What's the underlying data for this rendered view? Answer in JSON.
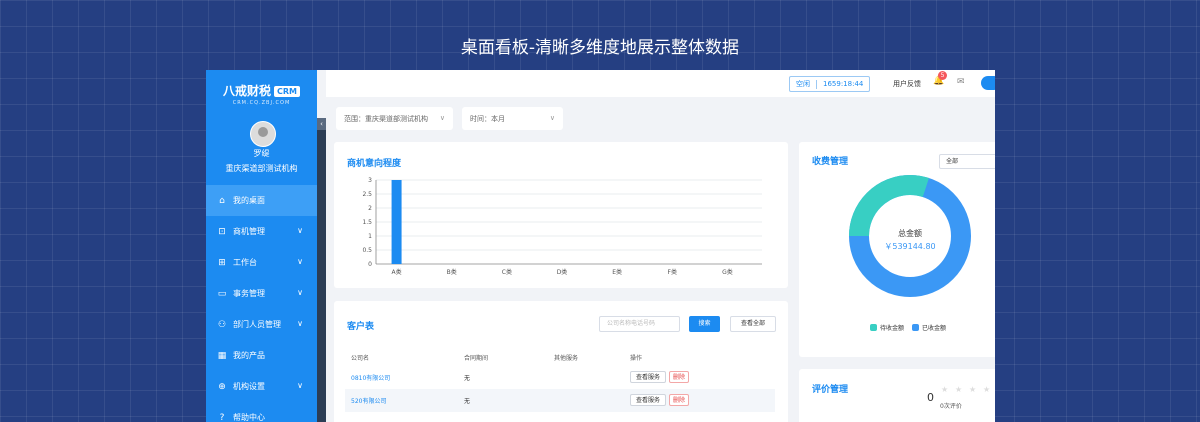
{
  "banner": {
    "title": "桌面看板-清晰多维度地展示整体数据"
  },
  "sidebar": {
    "logo_text": "八戒财税",
    "logo_badge": "CRM",
    "logo_sub": "CRM.CQ.ZBJ.COM",
    "user_name": "罗缇",
    "user_org": "重庆渠道部测试机构",
    "items": [
      {
        "label": "我的桌面",
        "icon": "home-icon",
        "glyph": "⌂"
      },
      {
        "label": "商机管理",
        "icon": "lock-icon",
        "glyph": "⊡"
      },
      {
        "label": "工作台",
        "icon": "workbench-icon",
        "glyph": "⊞"
      },
      {
        "label": "事务管理",
        "icon": "briefcase-icon",
        "glyph": "▭"
      },
      {
        "label": "部门人员管理",
        "icon": "user-group-icon",
        "glyph": "⚇"
      },
      {
        "label": "我的产品",
        "icon": "grid-icon",
        "glyph": "▦"
      },
      {
        "label": "机构设置",
        "icon": "org-icon",
        "glyph": "⊕"
      },
      {
        "label": "帮助中心",
        "icon": "help-icon",
        "glyph": "?"
      }
    ]
  },
  "topbar": {
    "status": "空闲",
    "timer": "1659:18:44",
    "feedback": "用户反馈",
    "badge": "5"
  },
  "filters": {
    "scope": "范围：重庆渠道部测试机构",
    "time": "时间：本月"
  },
  "opportunity": {
    "title": "商机意向程度"
  },
  "chart_data": {
    "type": "bar",
    "title": "商机意向程度",
    "categories": [
      "A类",
      "B类",
      "C类",
      "D类",
      "E类",
      "F类",
      "G类"
    ],
    "values": [
      3,
      0,
      0,
      0,
      0,
      0,
      0
    ],
    "y_ticks": [
      "0",
      "0.5",
      "1",
      "1.5",
      "2",
      "2.5",
      "3"
    ],
    "ylim": [
      0,
      3
    ],
    "grid": true,
    "colors": {
      "bar": "#1c8bf1"
    }
  },
  "customers": {
    "title": "客户表",
    "search_placeholder": "公司名称电话号码",
    "search_btn": "搜索",
    "view_all_btn": "查看全部",
    "columns": [
      "公司名",
      "合同期间",
      "其他服务",
      "操作"
    ],
    "rows": [
      {
        "company": "0810有限公司",
        "period": "无",
        "view": "查看服务",
        "delete": "删除"
      },
      {
        "company": "520有限公司",
        "period": "无",
        "view": "查看服务",
        "delete": "删除"
      }
    ]
  },
  "fees": {
    "title": "收费管理",
    "select": "全部",
    "center_label": "总金额",
    "total": "￥539144.80",
    "legend": [
      {
        "label": "待收金额",
        "color": "#38cfc3"
      },
      {
        "label": "已收金额",
        "color": "#3b98f5"
      }
    ],
    "share_pending": 0.3
  },
  "evaluation": {
    "title": "评价管理",
    "score": "0",
    "count": "0次评价"
  }
}
